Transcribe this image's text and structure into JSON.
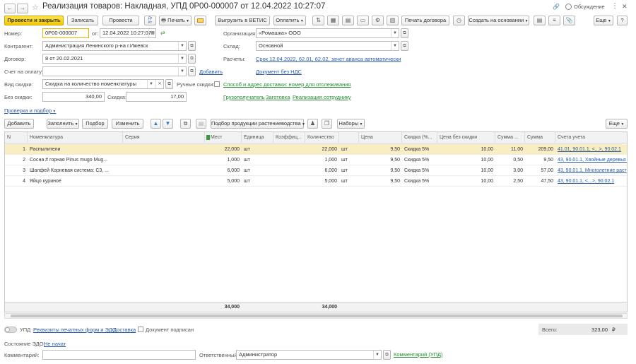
{
  "window": {
    "title": "Реализация товаров: Накладная, УПД 0Р00-000007 от 12.04.2022 10:27:07",
    "discussion_label": "Обсуждение",
    "more_icon": "⋮",
    "close_icon": "✕",
    "back_icon": "←",
    "forward_icon": "→",
    "star_icon": "☆",
    "link_icon": "🔗"
  },
  "toolbar": {
    "post_close": "Провести и закрыть",
    "save": "Записать",
    "post": "Провести",
    "print": "Печать",
    "upload_vetis": "Выгрузить в ВЕТИС",
    "pay": "Оплатить",
    "print_contract": "Печать договора",
    "create_based": "Создать на основании",
    "more": "Еще",
    "help": "?"
  },
  "form": {
    "number_label": "Номер:",
    "number_value": "0Р00-000007",
    "from_label": "от:",
    "date_value": "12.04.2022 10:27:07",
    "org_label": "Организация:",
    "org_value": "«Ромашка» ООО",
    "counterparty_label": "Контрагент:",
    "counterparty_value": "Администрация Ленинского р-на г.Ижевск",
    "warehouse_label": "Склад:",
    "warehouse_value": "Основной",
    "contract_label": "Договор:",
    "contract_value": "8 от 20.02.2021",
    "settlements_label": "Расчеты:",
    "settlements_link": "Срок 12.04.2022, 62.01, 62.02, зачет аванса автоматически",
    "invoice_label": "Счет на оплату:",
    "invoice_value": "",
    "add_link": "Добавить",
    "vat_link": "Документ без НДС",
    "discount_type_label": "Вид скидки:",
    "discount_type_value": "Скидка на количество номенклатуры",
    "manual_discounts_label": "Ручные скидки:",
    "delivery_link": "Способ и адрес доставки: номер для отслеживания",
    "no_discount_label": "Без скидки:",
    "no_discount_value": "340,00",
    "discount_label": "Скидка:",
    "discount_value": "17,00",
    "shipper_link": "Грузополучатель",
    "blank_link": "Заготовка",
    "employee_sale_link": "Реализация сотруднику",
    "selection_link": "Проверка и подбор"
  },
  "table_toolbar": {
    "add": "Добавить",
    "fill": "Заполнить",
    "pick": "Подбор",
    "change": "Изменить",
    "plant_products": "Подбор продукции растениеводства",
    "sets": "Наборы",
    "more": "Еще"
  },
  "table": {
    "headers": [
      "N",
      "Номенклатура",
      "Серия",
      "Мест",
      "Единица",
      "Коэффиц...",
      "Количество",
      "",
      "Цена",
      "Скидка (%...",
      "Цена без скидки",
      "Сумма ...",
      "Сумма",
      "Счета учета"
    ],
    "rows": [
      {
        "n": "1",
        "name": "Распылители",
        "series": "",
        "places": "22,000",
        "unit": "шт",
        "coef": "",
        "qty": "22,000",
        "qunit": "шт",
        "price": "9,50",
        "disc": "Скидка 5%",
        "price_nd": "10,00",
        "sum_d": "11,00",
        "sum": "209,00",
        "accounts": "41.01, 90.01.1, <...>, 90.02.1"
      },
      {
        "n": "2",
        "name": "Сосна # горная Pinus mugo Mug...",
        "series": "",
        "places": "1,000",
        "unit": "шт",
        "coef": "",
        "qty": "1,000",
        "qunit": "шт",
        "price": "9,50",
        "disc": "Скидка 5%",
        "price_nd": "10,00",
        "sum_d": "0,50",
        "sum": "9,50",
        "accounts": "43, 90.01.1, Хвойные деревья и к"
      },
      {
        "n": "3",
        "name": "Шалфей Корневая система: С3, ...",
        "series": "",
        "places": "6,000",
        "unit": "шт",
        "coef": "",
        "qty": "6,000",
        "qunit": "шт",
        "price": "9,50",
        "disc": "Скидка 5%",
        "price_nd": "10,00",
        "sum_d": "3,00",
        "sum": "57,00",
        "accounts": "43, 90.01.1, Многолетние раст"
      },
      {
        "n": "4",
        "name": "Яйцо куриное",
        "series": "",
        "places": "5,000",
        "unit": "шт",
        "coef": "",
        "qty": "5,000",
        "qunit": "шт",
        "price": "9,50",
        "disc": "Скидка 5%",
        "price_nd": "10,00",
        "sum_d": "2,50",
        "sum": "47,50",
        "accounts": "43, 90.01.1, <...>, 90.02.1"
      }
    ],
    "footer_places": "34,000",
    "footer_qty": "34,000"
  },
  "bottom": {
    "upd_label": "УПД",
    "print_details_link": "Реквизиты печатных форм и ЭДО",
    "delivery_link": "Доставка",
    "signed_label": "Документ подписан",
    "total_label": "Всего:",
    "total_value": "323,00",
    "currency": "₽",
    "edo_state_label": "Состояние ЭДО:",
    "edo_state_link": "Не начат",
    "comment_label": "Комментарий:",
    "comment_value": "",
    "responsible_label": "Ответственный:",
    "responsible_value": "Администратор",
    "comment_upd_link": "Комментарий (УПД)"
  }
}
